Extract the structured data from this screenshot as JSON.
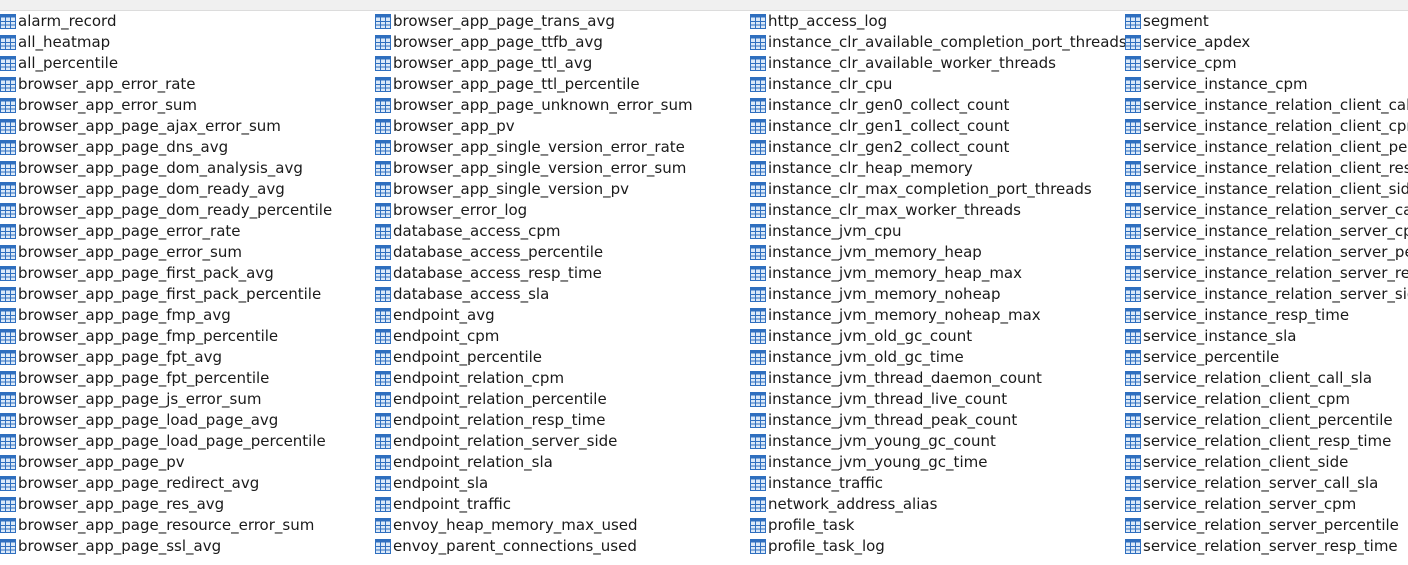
{
  "toolbar": {
    "items": []
  },
  "colors": {
    "table_icon_stroke": "#2f6fbf",
    "table_icon_fill": "#dbe9f8",
    "text": "#1a1a1a"
  },
  "columns": [
    [
      "alarm_record",
      "all_heatmap",
      "all_percentile",
      "browser_app_error_rate",
      "browser_app_error_sum",
      "browser_app_page_ajax_error_sum",
      "browser_app_page_dns_avg",
      "browser_app_page_dom_analysis_avg",
      "browser_app_page_dom_ready_avg",
      "browser_app_page_dom_ready_percentile",
      "browser_app_page_error_rate",
      "browser_app_page_error_sum",
      "browser_app_page_first_pack_avg",
      "browser_app_page_first_pack_percentile",
      "browser_app_page_fmp_avg",
      "browser_app_page_fmp_percentile",
      "browser_app_page_fpt_avg",
      "browser_app_page_fpt_percentile",
      "browser_app_page_js_error_sum",
      "browser_app_page_load_page_avg",
      "browser_app_page_load_page_percentile",
      "browser_app_page_pv",
      "browser_app_page_redirect_avg",
      "browser_app_page_res_avg",
      "browser_app_page_resource_error_sum",
      "browser_app_page_ssl_avg"
    ],
    [
      "browser_app_page_trans_avg",
      "browser_app_page_ttfb_avg",
      "browser_app_page_ttl_avg",
      "browser_app_page_ttl_percentile",
      "browser_app_page_unknown_error_sum",
      "browser_app_pv",
      "browser_app_single_version_error_rate",
      "browser_app_single_version_error_sum",
      "browser_app_single_version_pv",
      "browser_error_log",
      "database_access_cpm",
      "database_access_percentile",
      "database_access_resp_time",
      "database_access_sla",
      "endpoint_avg",
      "endpoint_cpm",
      "endpoint_percentile",
      "endpoint_relation_cpm",
      "endpoint_relation_percentile",
      "endpoint_relation_resp_time",
      "endpoint_relation_server_side",
      "endpoint_relation_sla",
      "endpoint_sla",
      "endpoint_traffic",
      "envoy_heap_memory_max_used",
      "envoy_parent_connections_used"
    ],
    [
      "http_access_log",
      "instance_clr_available_completion_port_threads",
      "instance_clr_available_worker_threads",
      "instance_clr_cpu",
      "instance_clr_gen0_collect_count",
      "instance_clr_gen1_collect_count",
      "instance_clr_gen2_collect_count",
      "instance_clr_heap_memory",
      "instance_clr_max_completion_port_threads",
      "instance_clr_max_worker_threads",
      "instance_jvm_cpu",
      "instance_jvm_memory_heap",
      "instance_jvm_memory_heap_max",
      "instance_jvm_memory_noheap",
      "instance_jvm_memory_noheap_max",
      "instance_jvm_old_gc_count",
      "instance_jvm_old_gc_time",
      "instance_jvm_thread_daemon_count",
      "instance_jvm_thread_live_count",
      "instance_jvm_thread_peak_count",
      "instance_jvm_young_gc_count",
      "instance_jvm_young_gc_time",
      "instance_traffic",
      "network_address_alias",
      "profile_task",
      "profile_task_log"
    ],
    [
      "segment",
      "service_apdex",
      "service_cpm",
      "service_instance_cpm",
      "service_instance_relation_client_call_",
      "service_instance_relation_client_cpm",
      "service_instance_relation_client_perc",
      "service_instance_relation_client_resp",
      "service_instance_relation_client_side",
      "service_instance_relation_server_call_",
      "service_instance_relation_server_cpm",
      "service_instance_relation_server_per",
      "service_instance_relation_server_resp",
      "service_instance_relation_server_side",
      "service_instance_resp_time",
      "service_instance_sla",
      "service_percentile",
      "service_relation_client_call_sla",
      "service_relation_client_cpm",
      "service_relation_client_percentile",
      "service_relation_client_resp_time",
      "service_relation_client_side",
      "service_relation_server_call_sla",
      "service_relation_server_cpm",
      "service_relation_server_percentile",
      "service_relation_server_resp_time"
    ]
  ]
}
